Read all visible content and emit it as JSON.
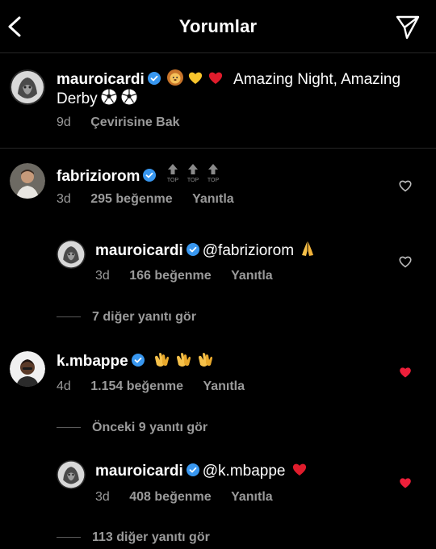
{
  "header": {
    "title": "Yorumlar"
  },
  "caption": {
    "username": "mauroicardi",
    "text_line1": "Amazing Night, Amazing",
    "text_line2": "Derby",
    "time": "9d",
    "translate": "Çevirisine Bak"
  },
  "comments": [
    {
      "username": "fabriziorom",
      "emoji_label": "TOP",
      "time": "3d",
      "likes": "295 beğenme",
      "reply": "Yanıtla",
      "liked": false
    },
    {
      "username": "mauroicardi",
      "mention": "@fabriziorom",
      "time": "3d",
      "likes": "166 beğenme",
      "reply": "Yanıtla",
      "liked": false
    },
    {
      "username": "k.mbappe",
      "time": "4d",
      "likes": "1.154 beğenme",
      "reply": "Yanıtla",
      "liked": true
    },
    {
      "username": "mauroicardi",
      "mention": "@k.mbappe",
      "time": "3d",
      "likes": "408 beğenme",
      "reply": "Yanıtla",
      "liked": true
    }
  ],
  "view_more": {
    "first": "7 diğer yanıtı gör",
    "previous": "Önceki 9 yanıtı gör",
    "last": "113 diğer yanıtı gör"
  },
  "colors": {
    "heart_red": "#ed1f3a",
    "verified_blue": "#3897f0",
    "muted": "#9a9a9a"
  }
}
